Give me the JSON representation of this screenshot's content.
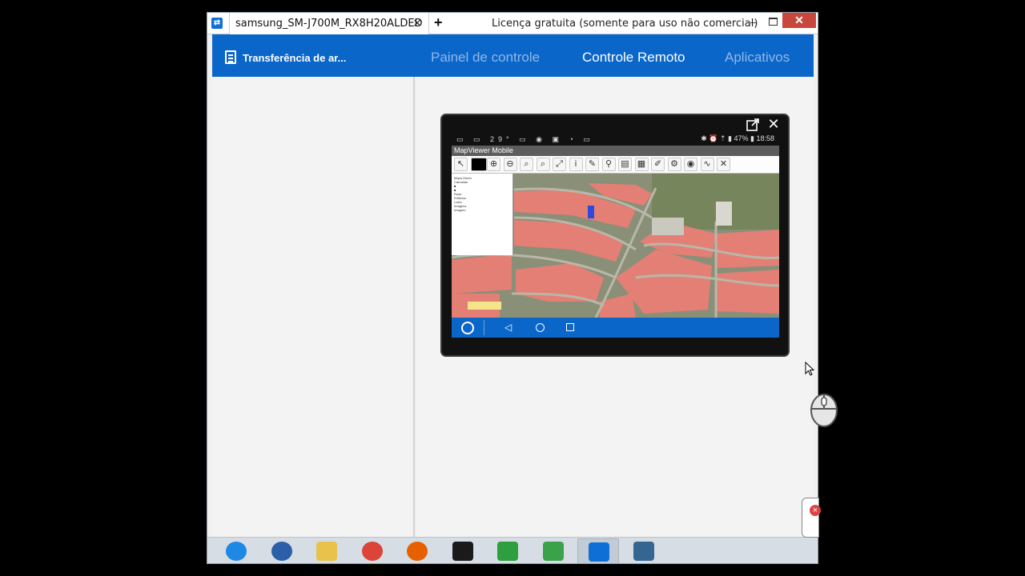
{
  "window": {
    "tab_title": "samsung_SM-J700M_RX8H20ALDED",
    "tab_close": "×",
    "new_tab": "+",
    "license_text": "Licença gratuita (somente para uso não comercial)",
    "min_label": "–",
    "close_label": "✕"
  },
  "header": {
    "file_transfer_label": "Transferência de ar...",
    "tabs": [
      {
        "label": "Painel de controle",
        "active": false
      },
      {
        "label": "Controle Remoto",
        "active": true
      },
      {
        "label": "Aplicativos",
        "active": false
      }
    ]
  },
  "device": {
    "close_label": "✕",
    "status_left": "▭ ▭ 29° ▭ ◉ ▣ ◔ ▭",
    "status_right": "✱ ⏰ ⇡ ▮ 47% ▮ 18:58",
    "app_title": "MapViewer Mobile",
    "toolbar_icons": [
      "pan-icon",
      "color-swatch-icon",
      "zoom-in-icon",
      "zoom-out-icon",
      "zoom-icon",
      "zoom-extent-icon",
      "full-extent-icon",
      "info-icon",
      "measure-icon",
      "marker-icon",
      "select-icon",
      "layers-icon",
      "edit-icon",
      "settings-icon",
      "globe-icon",
      "world-icon",
      "tools-icon"
    ],
    "layers": [
      "Mapa Direto",
      "Camadas",
      "■",
      "■",
      "Ruas",
      "Edificios",
      "Lotes",
      "Imagens",
      "Imagem"
    ],
    "nav": {
      "back": "◁"
    }
  },
  "taskbar": {
    "items": [
      {
        "name": "ie-icon",
        "color": "#1e88e5"
      },
      {
        "name": "thunderbird-icon",
        "color": "#2b5fa8"
      },
      {
        "name": "explorer-icon",
        "color": "#e8c24a"
      },
      {
        "name": "chrome-icon",
        "color": "#db4437"
      },
      {
        "name": "firefox-icon",
        "color": "#e66000"
      },
      {
        "name": "terminal-icon",
        "color": "#1a1a1a"
      },
      {
        "name": "download-icon",
        "color": "#2e9e3e"
      },
      {
        "name": "media-player-icon",
        "color": "#3aa34a"
      },
      {
        "name": "teamviewer-icon",
        "color": "#0e6fd6"
      },
      {
        "name": "postgres-icon",
        "color": "#336791"
      }
    ]
  }
}
